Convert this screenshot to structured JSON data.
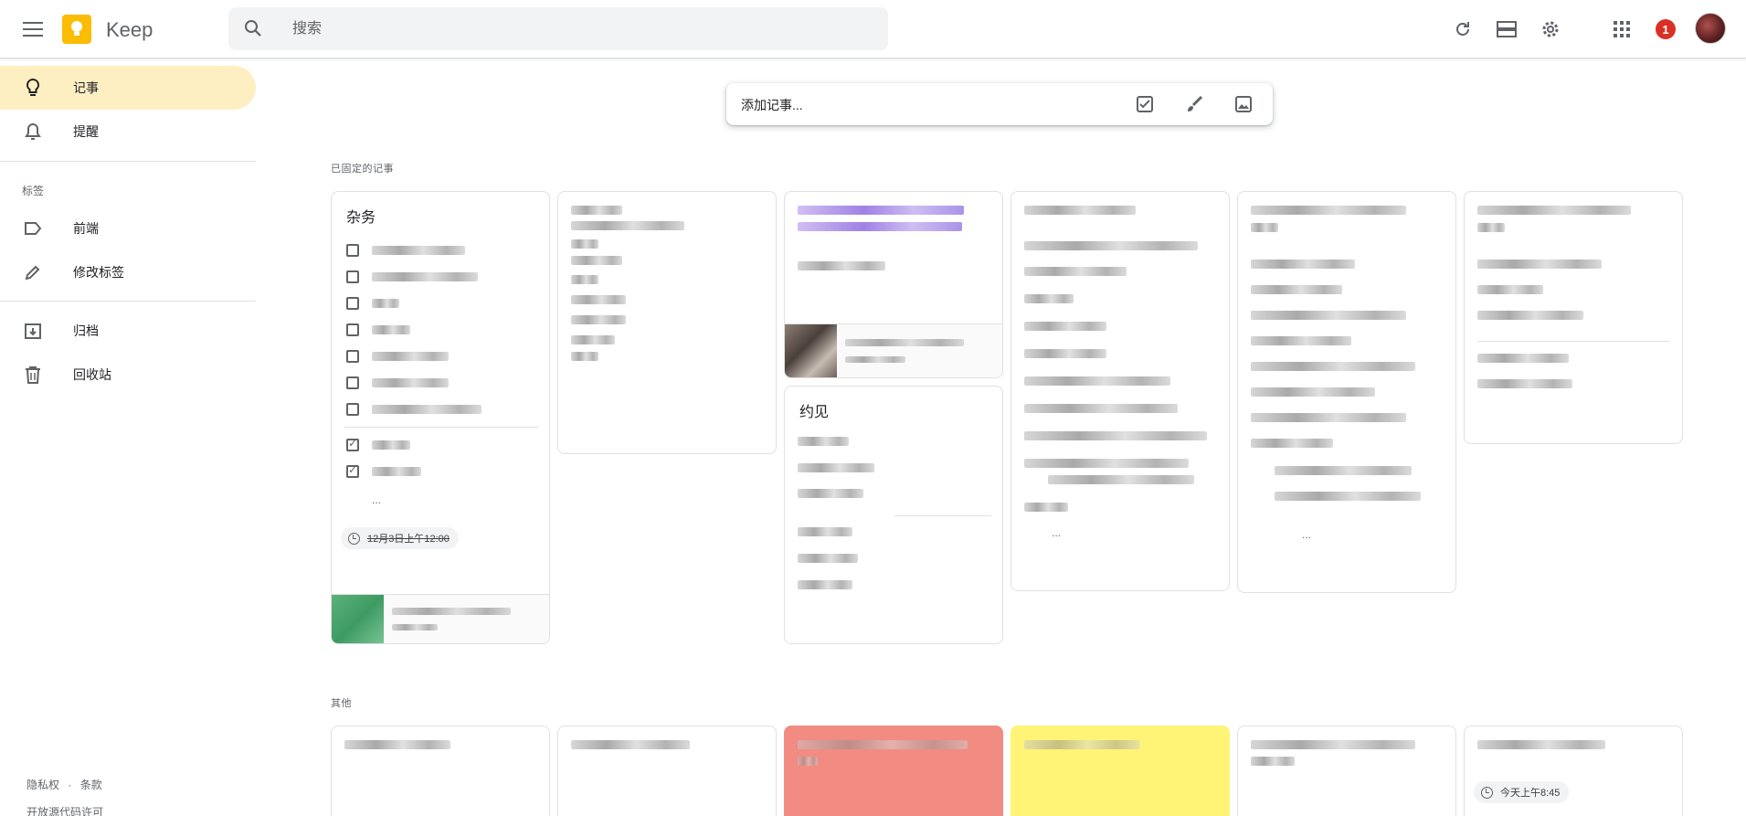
{
  "app": {
    "name": "Keep"
  },
  "search": {
    "placeholder": "搜索"
  },
  "header": {
    "notification_count": "1"
  },
  "sidebar": {
    "items": [
      {
        "label": "记事",
        "icon": "lightbulb-icon",
        "active": true
      },
      {
        "label": "提醒",
        "icon": "bell-icon",
        "active": false
      }
    ],
    "labels_section": "标签",
    "label_items": [
      {
        "label": "前端",
        "icon": "label-icon"
      },
      {
        "label": "修改标签",
        "icon": "pencil-icon"
      }
    ],
    "bottom_items": [
      {
        "label": "归档",
        "icon": "archive-icon"
      },
      {
        "label": "回收站",
        "icon": "trash-icon"
      }
    ],
    "footer": {
      "privacy": "隐私权",
      "separator": "·",
      "terms": "条款",
      "license": "开放源代码许可"
    }
  },
  "take_note": {
    "placeholder": "添加记事..."
  },
  "sections": {
    "pinned": "已固定的记事",
    "others": "其他"
  },
  "notes": {
    "pinned1": {
      "title": "杂务",
      "more": "...",
      "reminder": "12月3日上午12:00"
    },
    "pinned5": {
      "title": "约见"
    },
    "pinned_more": "...",
    "others6_reminder": "今天上午8:45"
  },
  "colors": {
    "active_nav": "#feefc3",
    "red_note": "#f28b82",
    "yellow_note": "#fff475",
    "logo": "#fbbc04",
    "badge": "#d93025"
  }
}
